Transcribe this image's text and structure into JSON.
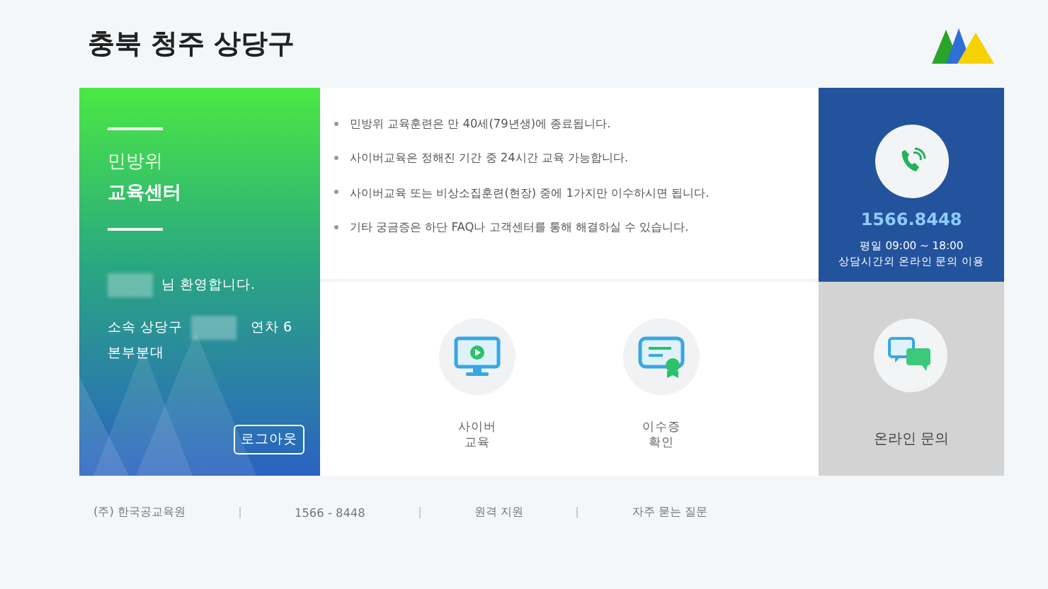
{
  "header": {
    "title": "충북 청주 상당구"
  },
  "welcome": {
    "title_light": "민방위",
    "title_bold": "교육센터",
    "greeting": "님 환영합니다.",
    "affiliation": "소속 상당구",
    "year_label": "연차 6",
    "unit": "본부분대",
    "logout": "로그아웃"
  },
  "notices": [
    "민방위 교육훈련은 만 40세(79년생)에 종료됩니다.",
    "사이버교육은 정해진 기간 중 24시간 교육 가능합니다.",
    "사이버교육 또는 비상소집훈련(현장) 중에 1가지만 이수하시면 됩니다.",
    "기타 궁금증은 하단 FAQ나 고객센터를 통해 해결하실 수 있습니다."
  ],
  "menu": [
    {
      "kind": "monitor",
      "label": "사이버\n교육"
    },
    {
      "kind": "certificate",
      "label": "이수증\n확인"
    }
  ],
  "contact": {
    "phone": "1566.8448",
    "hours": "평일 09:00 ~ 18:00",
    "note": "상담시간외 온라인 문의 이용"
  },
  "online": {
    "label": "온라인 문의"
  },
  "footer": [
    "(주) 한국공교육원",
    "1566 - 8448",
    "원격 지원",
    "자주 묻는 질문"
  ]
}
